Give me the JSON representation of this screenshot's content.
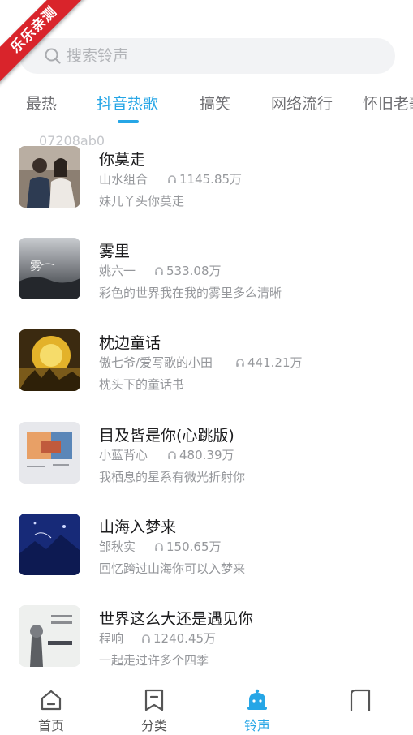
{
  "ribbon": {
    "text": "乐乐亲测"
  },
  "search": {
    "placeholder": "搜索铃声",
    "value": ""
  },
  "tabs": [
    {
      "label": "最热"
    },
    {
      "label": "抖音热歌",
      "active": true
    },
    {
      "label": "搞笑"
    },
    {
      "label": "网络流行"
    },
    {
      "label": "怀旧老歌"
    }
  ],
  "watermark": "07208ab0",
  "songs": [
    {
      "title": "你莫走",
      "artist": "山水组合",
      "plays": "1145.85万",
      "lyric": "妹儿丫头你莫走"
    },
    {
      "title": "雾里",
      "artist": "姚六一",
      "plays": "533.08万",
      "lyric": "彩色的世界我在我的雾里多么清晰"
    },
    {
      "title": "枕边童话",
      "artist": "傲七爷/爱写歌的小田",
      "plays": "441.21万",
      "lyric": "枕头下的童话书"
    },
    {
      "title": "目及皆是你(心跳版)",
      "artist": "小蓝背心",
      "plays": "480.39万",
      "lyric": "我栖息的星系有微光折射你"
    },
    {
      "title": "山海入梦来",
      "artist": "邹秋实",
      "plays": "150.65万",
      "lyric": "回忆跨过山海你可以入梦来"
    },
    {
      "title": "世界这么大还是遇见你",
      "artist": "程响",
      "plays": "1240.45万",
      "lyric": "一起走过许多个四季"
    }
  ],
  "nav": [
    {
      "label": "首页",
      "icon": "home-icon"
    },
    {
      "label": "分类",
      "icon": "bookmark-icon"
    },
    {
      "label": "铃声",
      "icon": "bell-icon",
      "active": true
    },
    {
      "label": "",
      "icon": "partial-icon"
    }
  ],
  "colors": {
    "accent": "#26a6e6",
    "ribbon": "#d9242b",
    "text_secondary": "#95979b"
  }
}
